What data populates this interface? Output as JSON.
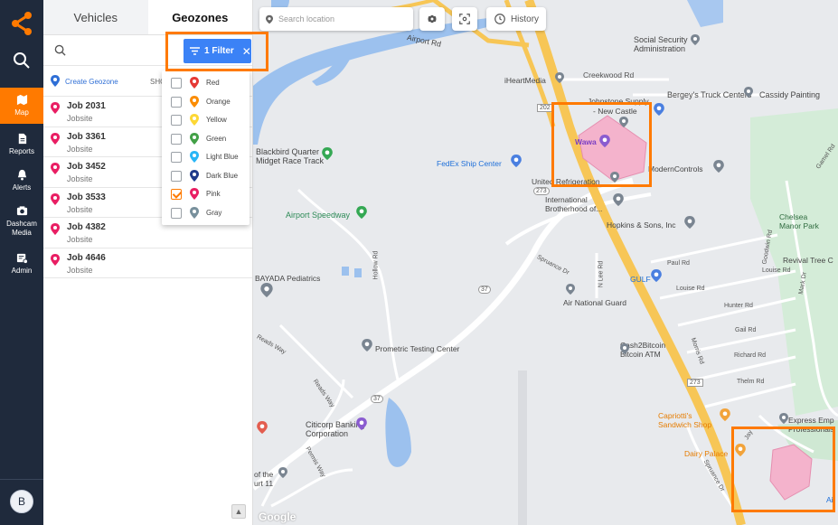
{
  "rail": {
    "items": [
      {
        "label": "Map"
      },
      {
        "label": "Reports"
      },
      {
        "label": "Alerts"
      },
      {
        "label": "Dashcam Media"
      },
      {
        "label": "Admin"
      }
    ],
    "avatar": "B"
  },
  "panel": {
    "tabs": [
      "Vehicles",
      "Geozones"
    ],
    "create_label": "Create Geozone",
    "show_label": "SHO",
    "jobs": [
      {
        "name": "Job 2031",
        "sub": "Jobsite"
      },
      {
        "name": "Job 3361",
        "sub": "Jobsite"
      },
      {
        "name": "Job 3452",
        "sub": "Jobsite"
      },
      {
        "name": "Job 3533",
        "sub": "Jobsite"
      },
      {
        "name": "Job 4382",
        "sub": "Jobsite"
      },
      {
        "name": "Job 4646",
        "sub": "Jobsite"
      }
    ]
  },
  "filter": {
    "button_label": "1 Filter",
    "options": [
      {
        "label": "Red",
        "color": "#e53935",
        "checked": false
      },
      {
        "label": "Orange",
        "color": "#fb8c00",
        "checked": false
      },
      {
        "label": "Yellow",
        "color": "#fdd835",
        "checked": false
      },
      {
        "label": "Green",
        "color": "#43a047",
        "checked": false
      },
      {
        "label": "Light Blue",
        "color": "#29b6f6",
        "checked": false
      },
      {
        "label": "Dark Blue",
        "color": "#1e3a8a",
        "checked": false
      },
      {
        "label": "Pink",
        "color": "#e91e63",
        "checked": true
      },
      {
        "label": "Gray",
        "color": "#78909c",
        "checked": false
      }
    ]
  },
  "map_controls": {
    "search_placeholder": "Search location",
    "history_label": "History"
  },
  "map_labels": {
    "airport_rd": "Airport Rd",
    "social_security": "Social Security\nAdministration",
    "creekwood": "Creekwood Rd",
    "iheart": "iHeartMedia",
    "johnstone": "Johnstone Supply",
    "new_castle": "- New Castle",
    "bergeys": "Bergey's Truck Centers",
    "cassidy": "Cassidy Painting",
    "wawa": "Wawa",
    "fedex": "FedEx Ship Center",
    "blackbird": "Blackbird Quarter\nMidget Race Track",
    "united": "United Refrigeration",
    "modern": "ModernControls",
    "intl_bro": "International\nBrotherhood of...",
    "hopkins": "Hopkins & Sons, Inc",
    "chelsea": "Chelsea\nManor Park",
    "airport_speedway": "Airport Speedway",
    "hollow_rd": "Hollow Rd",
    "spruance": "Spruance Dr",
    "paul_rd": "Paul Rd",
    "louise_rd": "Louise Rd",
    "revival": "Revival Tree C",
    "bayada": "BAYADA Pediatrics",
    "gulf": "GULF",
    "air_guard": "Air National Guard",
    "hunter": "Hunter Rd",
    "gail": "Gail Rd",
    "richard": "Richard Rd",
    "thelm": "Thelm Rd",
    "prometric": "Prometric Testing Center",
    "cash2bitcoin": "Cash2Bitcoin\nBitcoin ATM",
    "reads_way": "Reads Way",
    "citicorp": "Citicorp Banking\nCorporation",
    "capriottis": "Capriotti's\nSandwich Shop",
    "express": "Express Emp\nProfessionals",
    "dairy_palace": "Dairy Palace",
    "of_the": "of the\nurt 11",
    "google": "Google",
    "n_lee": "N Lee Rd",
    "morris": "Morris Rd",
    "jay": "Jay",
    "goodwin": "Goodwin Rd",
    "mark": "Mark Dr",
    "gamel": "Gamel Rd",
    "spruance_dr2": "Spruance Dr",
    "permis": "Permis Way",
    "r202": "202",
    "r37": "37",
    "r37b": "37",
    "r273": "273",
    "r273b": "273",
    "ap": "Ai"
  }
}
